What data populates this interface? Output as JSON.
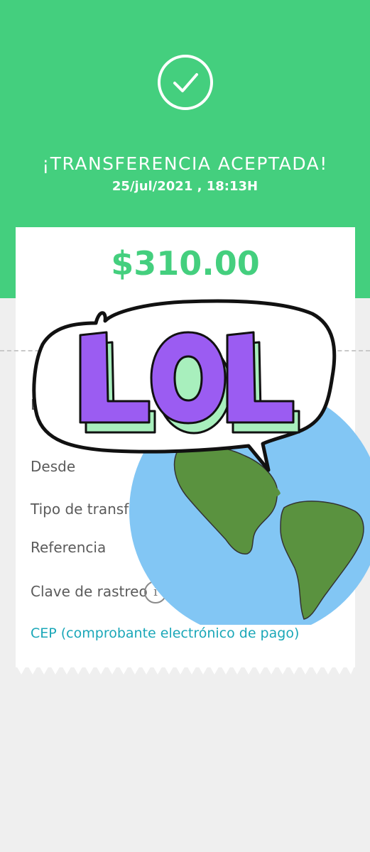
{
  "header": {
    "title": "¡TRANSFERENCIA ACEPTADA!",
    "datetime": "25/jul/2021 , 18:13H",
    "check_icon": "checkmark-circle-icon"
  },
  "receipt": {
    "amount": "$310.00",
    "rows": {
      "first_partial": "D",
      "desde": "Desde",
      "tipo": "Tipo de transfe",
      "referencia": "Referencia",
      "clave": "Clave de rastreo"
    },
    "info_icon_glyph": "i",
    "cep_link": "CEP (comprobante electrónico de pago)"
  },
  "sticker": {
    "text": "LOL",
    "globe_icon": "globe-icon"
  },
  "colors": {
    "brand_green": "#44cf7e",
    "link_teal": "#1aa7b8",
    "background": "#efefef",
    "globe_ocean": "#82c6f4",
    "globe_land": "#5a923f",
    "lol_purple": "#9b5cf2",
    "lol_mint": "#a8efbd"
  }
}
